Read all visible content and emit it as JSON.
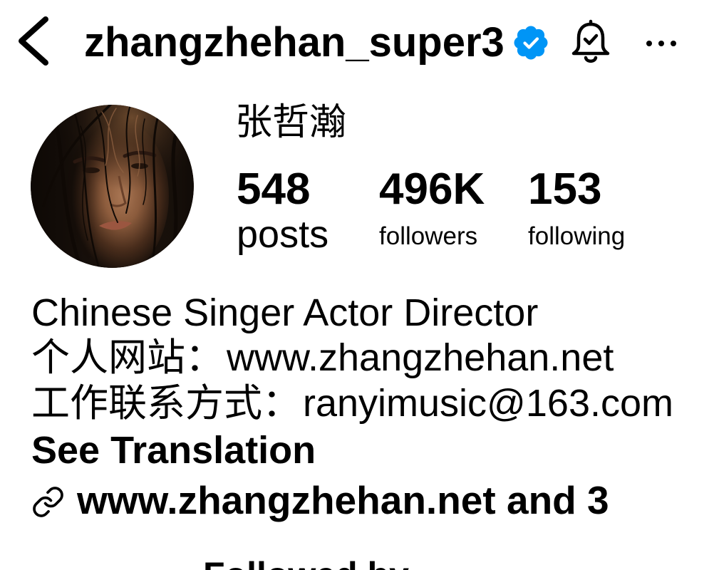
{
  "header": {
    "username": "zhangzhehan_super3",
    "icons": {
      "back": "chevron-left-icon",
      "verified": "verified-badge-icon",
      "notifications": "bell-check-icon",
      "more": "more-horizontal-icon"
    }
  },
  "profile": {
    "display_name": "张哲瀚",
    "stats": {
      "posts": {
        "value": "548",
        "label": "posts"
      },
      "followers": {
        "value": "496K",
        "label": "followers"
      },
      "following": {
        "value": "153",
        "label": "following"
      }
    }
  },
  "bio": {
    "line_1": "Chinese Singer Actor Director",
    "website_label": "个人网站：",
    "website": "www.zhangzhehan.net",
    "contact_label": "工作联系方式：",
    "contact": "ranyimusic@163.com",
    "see_translation": "See Translation",
    "links": {
      "icon": "link-icon",
      "text": "www.zhangzhehan.net and 3"
    }
  },
  "followed_by": {
    "text": "Followed by"
  },
  "colors": {
    "background": "#ffffff",
    "text": "#000000",
    "verified": "#0095F6"
  }
}
